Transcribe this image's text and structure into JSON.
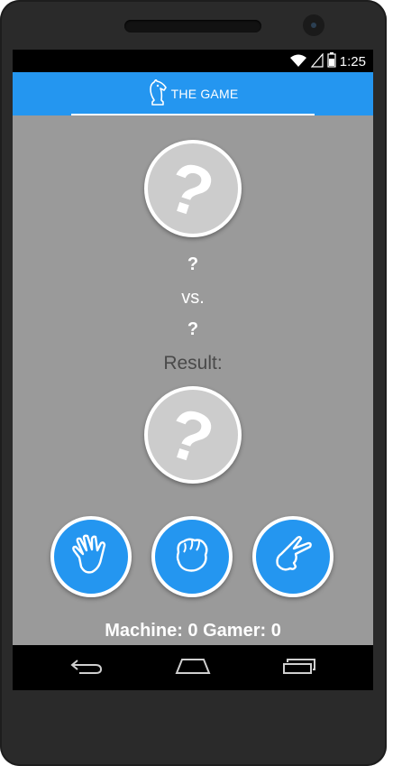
{
  "status_bar": {
    "time": "1:25",
    "icons": [
      "wifi-icon",
      "signal-icon",
      "battery-icon"
    ]
  },
  "app_bar": {
    "tab_label": "THE GAME",
    "tab_icon": "chess-knight-icon",
    "color": "#2496f0"
  },
  "game": {
    "top_circle_symbol": "?",
    "machine_selection": "?",
    "vs_label": "vs.",
    "gamer_selection": "?",
    "result_label": "Result:",
    "result_symbol": "?",
    "choices": [
      {
        "name": "paper",
        "icon": "open-hand-icon"
      },
      {
        "name": "rock",
        "icon": "fist-icon"
      },
      {
        "name": "scissors",
        "icon": "scissors-hand-icon"
      }
    ],
    "score_text": "Machine: 0 Gamer: 0"
  },
  "nav_bar": {
    "buttons": [
      "back-icon",
      "home-icon",
      "recent-apps-icon"
    ]
  }
}
